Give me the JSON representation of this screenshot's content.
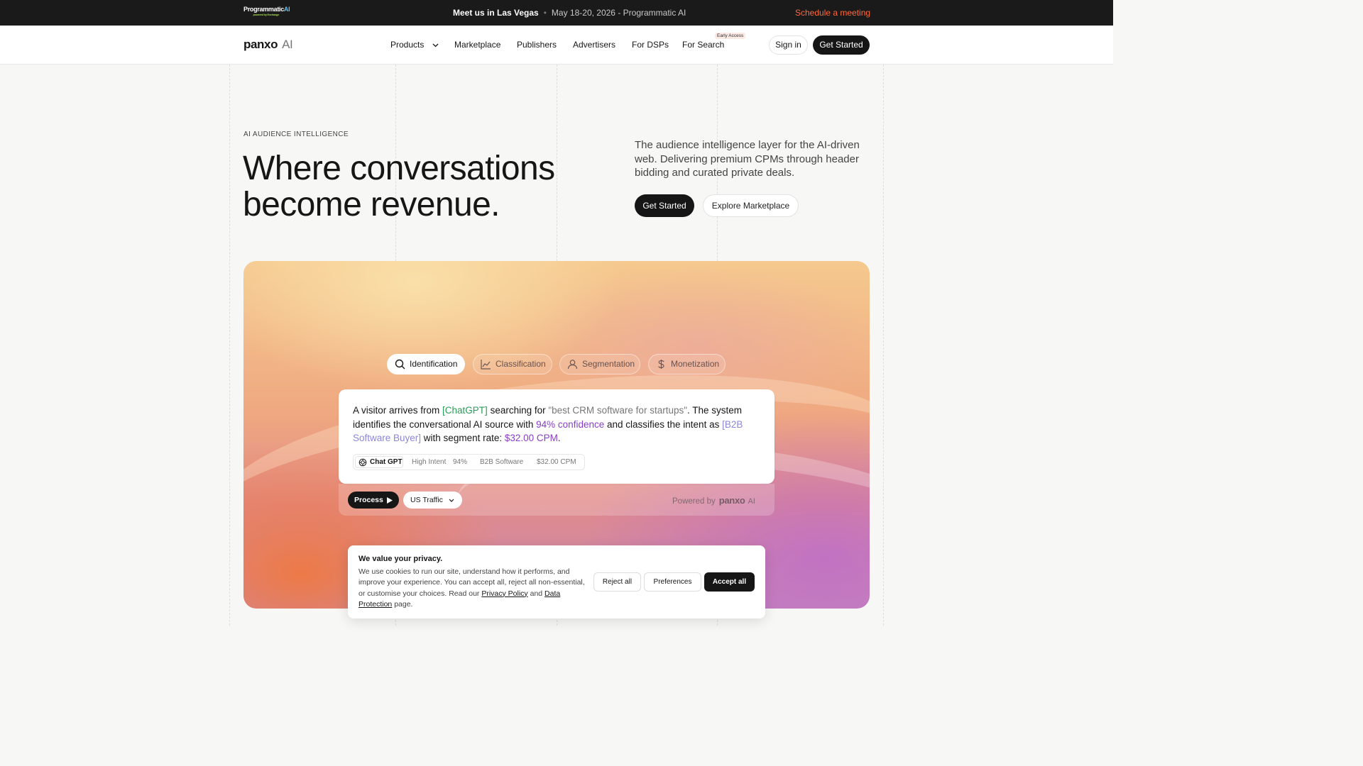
{
  "topbar": {
    "logo_line1": "Programmatic",
    "logo_line2": "AI",
    "logo_small": "powered by Exchange",
    "event_label": "Meet us in Las Vegas",
    "event_details": "May 18-20, 2026 - Programmatic AI",
    "cta": "Schedule a meeting"
  },
  "nav": {
    "brand": "panxo",
    "brand_suffix": "AI",
    "links": [
      "Products",
      "Marketplace",
      "Publishers",
      "Advertisers",
      "For DSPs",
      "For Search"
    ],
    "badge": "Early Access",
    "sign_in": "Sign in",
    "get_started": "Get Started"
  },
  "hero": {
    "eyebrow": "AI AUDIENCE INTELLIGENCE",
    "headline_line1": "Where conversations",
    "headline_line2": "become revenue.",
    "lede": "The audience intelligence layer for the AI-driven web. Delivering premium CPMs through header bidding and curated private deals.",
    "cta_primary": "Get Started",
    "cta_secondary": "Explore Marketplace"
  },
  "demo": {
    "tabs": [
      "Identification",
      "Classification",
      "Segmentation",
      "Monetization"
    ],
    "active_tab": "Identification",
    "text": {
      "t1": "A visitor arrives from ",
      "source": "[ChatGPT]",
      "t2": " searching for ",
      "query": "\"best CRM software for startups\"",
      "t3": ". The system identifies the conversational AI source with ",
      "confidence": "94% confidence",
      "t4": " and classifies the intent as ",
      "segment": "[B2B Software Buyer]",
      "t5": " with segment rate: ",
      "rate": "$32.00 CPM",
      "t6": "."
    },
    "chips": {
      "source": "Chat GPT",
      "intent": "High Intent",
      "confidence": "94%",
      "category": "B2B Software",
      "cpm": "$32.00 CPM"
    },
    "process_button": "Process",
    "traffic_select": "US Traffic",
    "powered_by": "Powered by",
    "powered_brand": "panxo",
    "powered_suffix": "AI"
  },
  "cookie": {
    "title": "We value your privacy.",
    "body_prefix": "We use cookies to run our site, understand how it performs, and improve your experience. You can accept all, reject all non-essential, or customise your choices. Read our ",
    "privacy_link": "Privacy Policy",
    "body_mid": " and ",
    "data_link": "Data Protection",
    "body_suffix": " page.",
    "reject": "Reject all",
    "preferences": "Preferences",
    "accept": "Accept all"
  },
  "colors": {
    "accent_orange": "#ff6a3d",
    "dark": "#161616",
    "highlight_green": "#2a9d57",
    "highlight_purple": "#8a3cc8",
    "highlight_lavender": "#8d86d9"
  }
}
